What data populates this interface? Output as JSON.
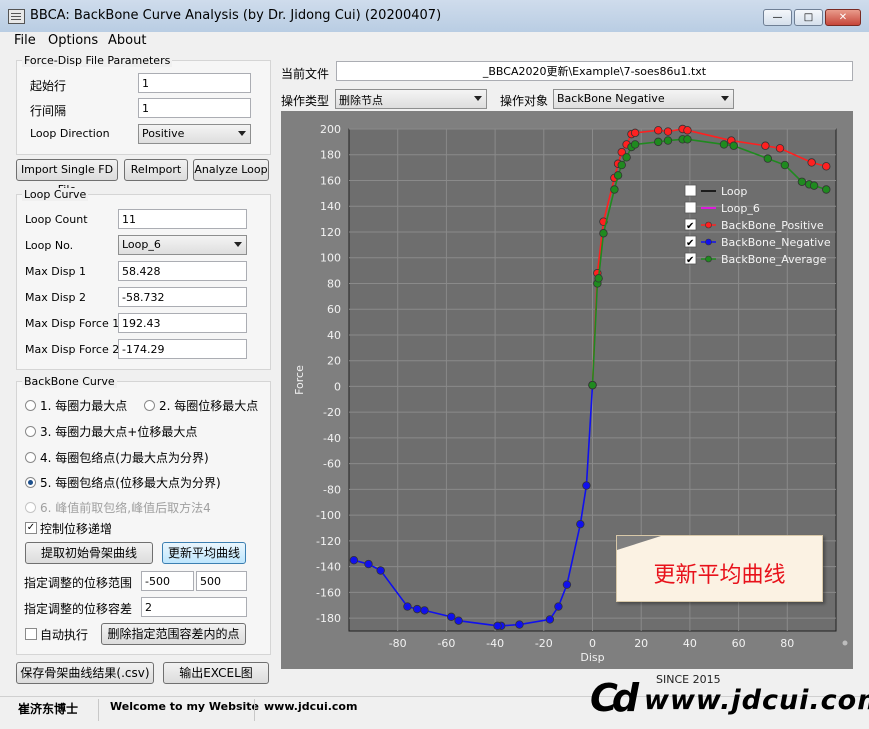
{
  "window": {
    "title": "BBCA: BackBone Curve Analysis (by Dr. Jidong Cui) (20200407)"
  },
  "menu": [
    "File",
    "Options",
    "About"
  ],
  "fd_params": {
    "title": "Force-Disp File Parameters",
    "start_row_label": "起始行",
    "start_row": "1",
    "row_interval_label": "行间隔",
    "row_interval": "1",
    "loop_direction_label": "Loop Direction",
    "loop_direction": "Positive"
  },
  "buttons": {
    "import": "Import Single FD File",
    "reimport": "ReImport",
    "analyze": "Analyze Loop"
  },
  "loop_curve": {
    "title": "Loop Curve",
    "count_label": "Loop Count",
    "count": "11",
    "no_label": "Loop No.",
    "no": "Loop_6",
    "max_disp1_label": "Max Disp 1",
    "max_disp1": "58.428",
    "max_disp2_label": "Max Disp 2",
    "max_disp2": "-58.732",
    "max_force1_label": "Max Disp Force 1",
    "max_force1": "192.43",
    "max_force2_label": "Max Disp Force 2",
    "max_force2": "-174.29"
  },
  "backbone": {
    "title": "BackBone Curve",
    "opt1": "1. 每圈力最大点",
    "opt2": "2. 每圈位移最大点",
    "opt3": "3. 每圈力最大点+位移最大点",
    "opt4": "4. 每圈包络点(力最大点为分界)",
    "opt5": "5. 每圈包络点(位移最大点为分界)",
    "opt6": "6. 峰值前取包络,峰值后取方法4",
    "selected": "opt5",
    "increase_label": "控制位移递增",
    "extract_btn": "提取初始骨架曲线",
    "update_btn": "更新平均曲线",
    "range_label": "指定调整的位移范围",
    "range_min": "-500",
    "range_max": "500",
    "tol_label": "指定调整的位移容差",
    "tol": "2",
    "auto_label": "自动执行",
    "delete_btn": "删除指定范围容差内的点"
  },
  "bottom_buttons": {
    "save": "保存骨架曲线结果(.csv)",
    "excel": "输出EXCEL图"
  },
  "status": [
    "崔济东博士",
    "Welcome to my Website",
    "www.jdcui.com"
  ],
  "file": {
    "label": "当前文件",
    "path": "_BBCA2020更新\\Example\\7-soes86u1.txt"
  },
  "ops": {
    "type_label": "操作类型",
    "type": "删除节点",
    "target_label": "操作对象",
    "target": "BackBone Negative"
  },
  "callout": "更新平均曲线",
  "logo": {
    "text": "www.jdcui.com",
    "since": "SINCE 2015"
  },
  "colors": {
    "plot_bg": "#7f7f7f",
    "positive": "#ff2020",
    "negative": "#1010ee",
    "average": "#1f8a1f",
    "loop6": "#ff00ff",
    "callout_text": "#e8121b"
  },
  "chart_data": {
    "type": "line",
    "xlabel": "Disp",
    "ylabel": "Force",
    "xlim": [
      -100,
      100
    ],
    "ylim": [
      -190,
      200
    ],
    "xticks": [
      -80,
      -60,
      -40,
      -20,
      0,
      20,
      40,
      60,
      80
    ],
    "yticks": [
      -180,
      -160,
      -140,
      -120,
      -100,
      -80,
      -60,
      -40,
      -20,
      0,
      20,
      40,
      60,
      80,
      100,
      120,
      140,
      160,
      180,
      200
    ],
    "legend": "top-right",
    "series": [
      {
        "name": "Loop",
        "checked": false,
        "color": "#000000",
        "points": []
      },
      {
        "name": "Loop_6",
        "checked": false,
        "color": "#ff00ff",
        "points": []
      },
      {
        "name": "BackBone_Positive",
        "checked": true,
        "color": "#ff2020",
        "points": [
          [
            0,
            1
          ],
          [
            2,
            88
          ],
          [
            4.5,
            128
          ],
          [
            9,
            162
          ],
          [
            10.5,
            173
          ],
          [
            12,
            182
          ],
          [
            14,
            188
          ],
          [
            16,
            196
          ],
          [
            17.5,
            197
          ],
          [
            27,
            199
          ],
          [
            31,
            198
          ],
          [
            37,
            200
          ],
          [
            39,
            199
          ],
          [
            57,
            191
          ],
          [
            71,
            187
          ],
          [
            77,
            185
          ],
          [
            90,
            174
          ],
          [
            96,
            171
          ]
        ]
      },
      {
        "name": "BackBone_Negative",
        "checked": true,
        "color": "#1010ee",
        "points": [
          [
            0,
            1
          ],
          [
            -2.5,
            -77
          ],
          [
            -5,
            -107
          ],
          [
            -10.5,
            -154
          ],
          [
            -14,
            -171
          ],
          [
            -17.5,
            -181
          ],
          [
            -30,
            -185
          ],
          [
            -37.5,
            -186
          ],
          [
            -39,
            -186
          ],
          [
            -55,
            -182
          ],
          [
            -58,
            -179
          ],
          [
            -69,
            -174
          ],
          [
            -72,
            -173
          ],
          [
            -76,
            -171
          ],
          [
            -87,
            -143
          ],
          [
            -92,
            -138
          ],
          [
            -98,
            -135
          ]
        ]
      },
      {
        "name": "BackBone_Average",
        "checked": true,
        "color": "#1f8a1f",
        "points": [
          [
            0,
            1
          ],
          [
            2,
            80
          ],
          [
            2.5,
            84
          ],
          [
            4.5,
            119
          ],
          [
            9,
            153
          ],
          [
            10.5,
            164
          ],
          [
            12,
            172
          ],
          [
            14,
            178
          ],
          [
            16,
            186
          ],
          [
            17.5,
            188
          ],
          [
            27,
            190
          ],
          [
            31,
            191
          ],
          [
            37,
            192
          ],
          [
            39,
            192
          ],
          [
            54,
            188
          ],
          [
            58,
            187
          ],
          [
            72,
            177
          ],
          [
            79,
            172
          ],
          [
            86,
            159
          ],
          [
            89,
            157
          ],
          [
            91,
            156
          ],
          [
            96,
            153
          ]
        ]
      }
    ]
  }
}
